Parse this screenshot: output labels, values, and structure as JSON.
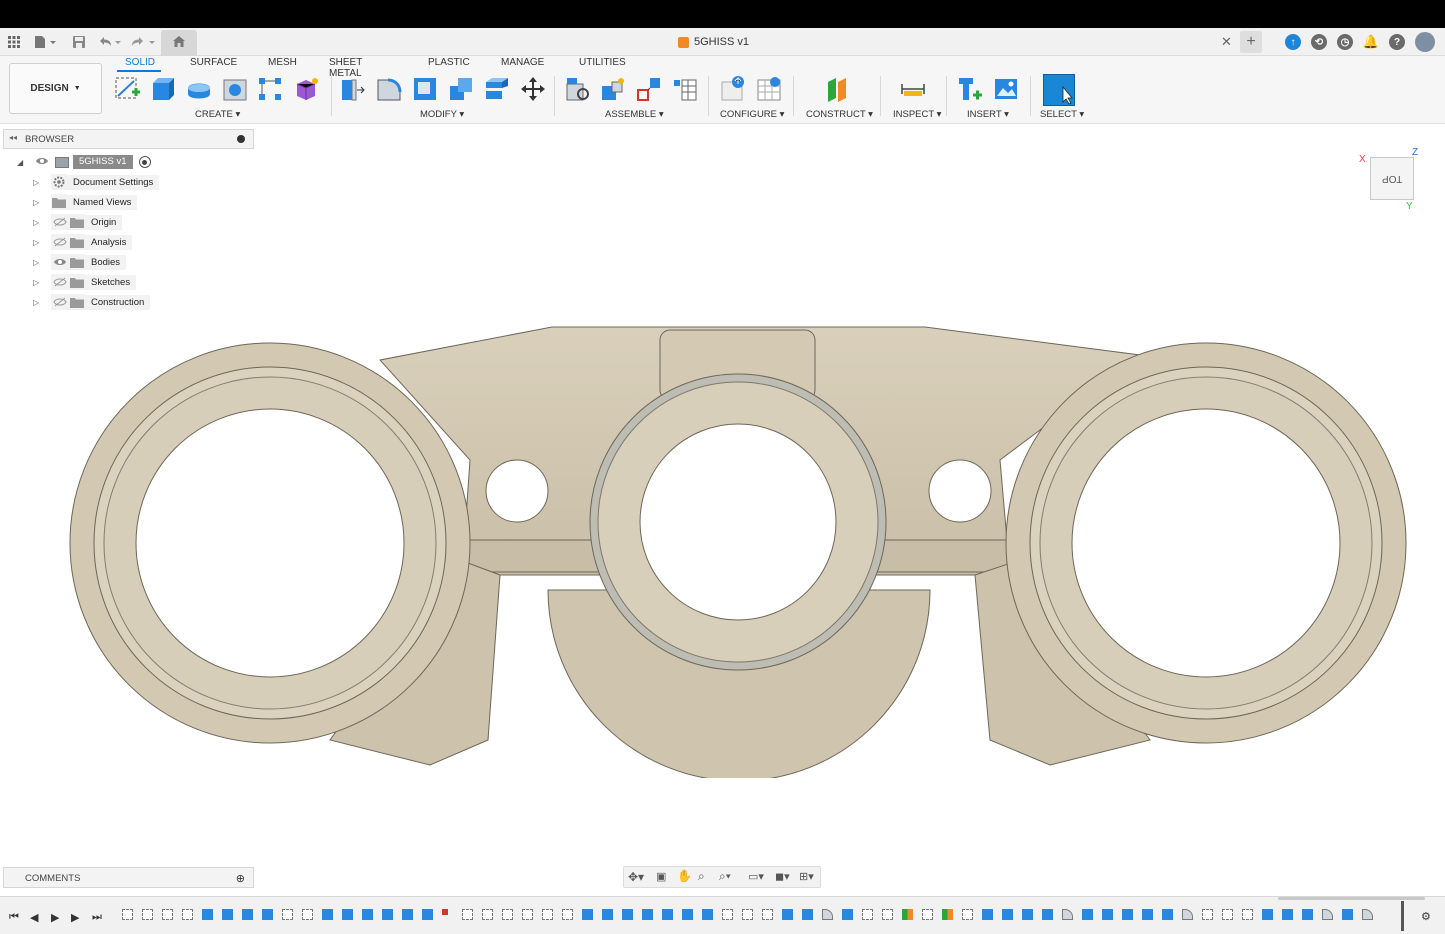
{
  "app": {
    "document_title": "5GHISS v1",
    "workspace": "DESIGN"
  },
  "toolbar": {
    "tabs": [
      "SOLID",
      "SURFACE",
      "MESH",
      "SHEET METAL",
      "PLASTIC",
      "MANAGE",
      "UTILITIES"
    ],
    "active_tab": "SOLID",
    "groups": [
      "CREATE",
      "MODIFY",
      "ASSEMBLE",
      "CONFIGURE",
      "CONSTRUCT",
      "INSPECT",
      "INSERT",
      "SELECT"
    ]
  },
  "browser": {
    "title": "BROWSER",
    "root": "5GHISS v1",
    "items": [
      {
        "label": "Document Settings",
        "icon": "gear-icon",
        "visible": null
      },
      {
        "label": "Named Views",
        "icon": "folder-icon",
        "visible": null
      },
      {
        "label": "Origin",
        "icon": "folder-icon",
        "visible": false
      },
      {
        "label": "Analysis",
        "icon": "folder-icon",
        "visible": false
      },
      {
        "label": "Bodies",
        "icon": "folder-icon",
        "visible": true
      },
      {
        "label": "Sketches",
        "icon": "folder-icon",
        "visible": false
      },
      {
        "label": "Construction",
        "icon": "folder-icon",
        "visible": false
      }
    ]
  },
  "viewcube": {
    "face_label": "TOP",
    "axis_x": "X",
    "axis_y": "Y",
    "axis_z": "Z"
  },
  "comments": {
    "title": "COMMENTS"
  },
  "colors": {
    "accent": "#0a7bd8",
    "model_fill": "#d8cfbb",
    "model_edge": "#6d6659"
  }
}
